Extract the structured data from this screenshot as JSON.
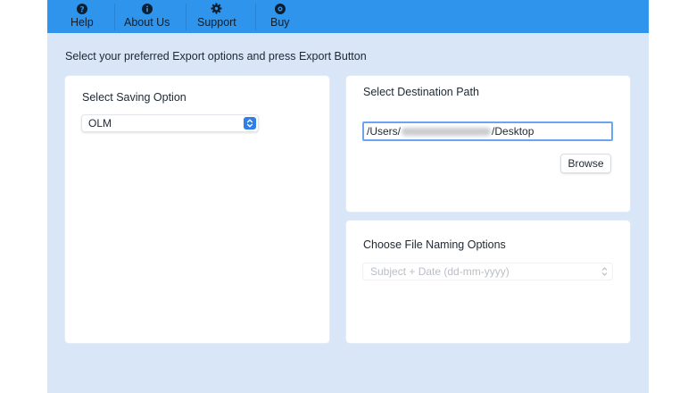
{
  "toolbar": {
    "items": [
      {
        "label": "Help",
        "icon": "help-icon"
      },
      {
        "label": "About Us",
        "icon": "info-icon"
      },
      {
        "label": "Support",
        "icon": "gear-icon"
      },
      {
        "label": "Buy",
        "icon": "buy-icon"
      }
    ],
    "color": "#2f95ec"
  },
  "instruction": "Select your preferred Export options and press Export Button",
  "saving": {
    "title": "Select Saving Option",
    "selected": "OLM"
  },
  "destination": {
    "title": "Select Destination Path",
    "path_prefix": "/Users/",
    "path_suffix": "/Desktop",
    "browse_label": "Browse"
  },
  "naming": {
    "title": "Choose File Naming Options",
    "selected": "Subject + Date (dd-mm-yyyy)"
  }
}
